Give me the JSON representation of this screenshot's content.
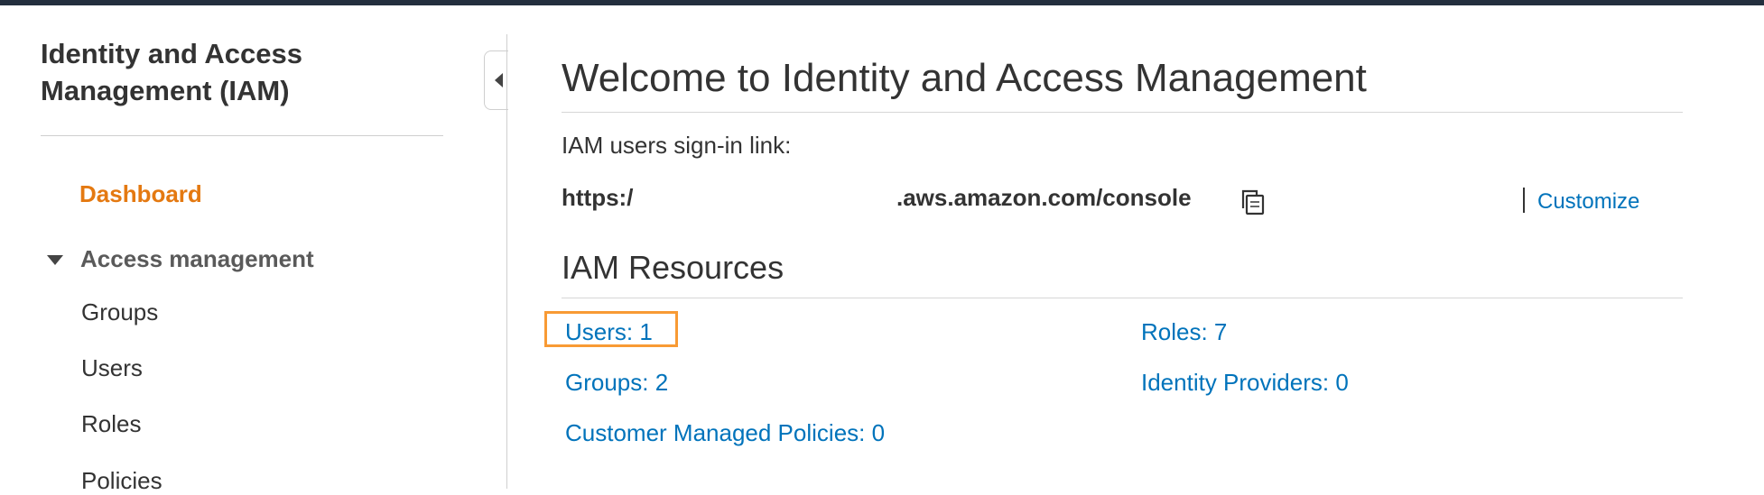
{
  "sidebar": {
    "title": "Identity and Access Management (IAM)",
    "dashboard_label": "Dashboard",
    "section_label": "Access management",
    "items": [
      {
        "label": "Groups"
      },
      {
        "label": "Users"
      },
      {
        "label": "Roles"
      },
      {
        "label": "Policies"
      }
    ]
  },
  "main": {
    "title": "Welcome to Identity and Access Management",
    "signin_label": "IAM users sign-in link:",
    "signin_url_prefix": "https:/",
    "signin_url_suffix": ".aws.amazon.com/console",
    "customize_label": "Customize",
    "resources_title": "IAM Resources",
    "resources": {
      "users": "Users: 1",
      "roles": "Roles: 7",
      "groups": "Groups: 2",
      "identity_providers": "Identity Providers: 0",
      "customer_managed_policies": "Customer Managed Policies: 0"
    }
  },
  "colors": {
    "accent_orange": "#e47911",
    "link_blue": "#0073bb",
    "highlight": "#f89a34",
    "topbar": "#232f3e"
  },
  "icons": {
    "copy": "copy-icon",
    "collapse": "caret-left-icon",
    "section_toggle": "caret-down-icon"
  }
}
